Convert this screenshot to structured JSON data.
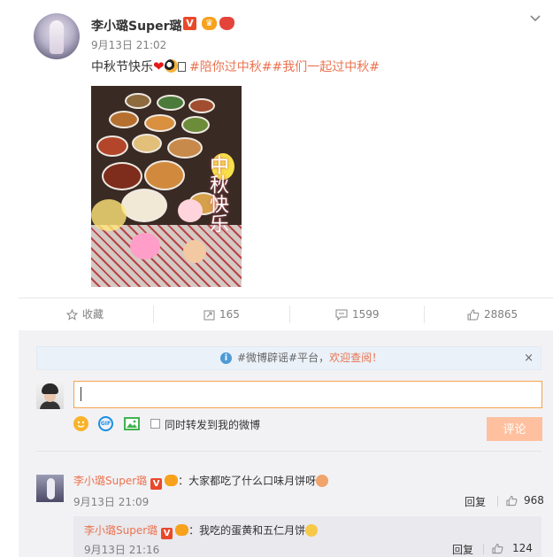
{
  "post": {
    "author": "李小璐Super璐",
    "verified_badge": "V",
    "time": "9月13日 21:02",
    "text": "中秋节快乐",
    "hashtags": "#陪你过中秋##我们一起过中秋#",
    "image_overlay_text": "中秋快乐"
  },
  "actions": {
    "favorite_label": "收藏",
    "repost_count": "165",
    "comment_count": "1599",
    "like_count": "28865"
  },
  "notice": {
    "text": "#微博辟谣#平台，",
    "link": "欢迎查阅！",
    "close": "×"
  },
  "composer": {
    "input_value": "",
    "forward_label": "同时转发到我的微博",
    "submit_label": "评论"
  },
  "comments": [
    {
      "author": "李小璐Super璐",
      "text": "：大家都吃了什么口味月饼呀",
      "time": "9月13日 21:09",
      "reply_label": "回复",
      "likes": "968"
    }
  ],
  "sub_comments": [
    {
      "author": "李小璐Super璐",
      "text": "：我吃的蛋黄和五仁月饼",
      "time": "9月13日 21:16",
      "reply_label": "回复",
      "likes": "124"
    }
  ],
  "colors": {
    "accent": "#eb7350",
    "verified": "#e8492b",
    "submit_bg": "#ffc09f",
    "notice_bg": "#eaf1f8"
  },
  "icons": [
    "chevron-down-icon",
    "star-icon",
    "repost-icon",
    "comment-icon",
    "thumb-up-icon",
    "info-icon",
    "close-icon",
    "smile-icon",
    "gif-icon",
    "image-icon"
  ]
}
